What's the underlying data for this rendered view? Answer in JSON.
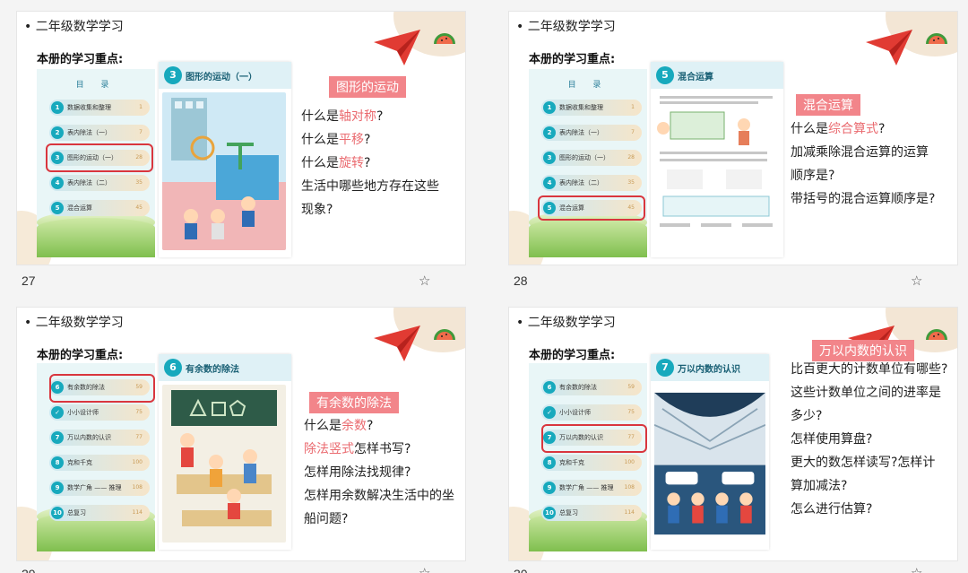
{
  "slides": [
    {
      "number": "27",
      "header": "二年级数学学习",
      "subheading": "本册的学习重点:",
      "toc_title": "目 录",
      "toc": [
        {
          "n": "1",
          "label": "数据收集和整理",
          "page": "1"
        },
        {
          "n": "2",
          "label": "表内除法（一）",
          "page": "7"
        },
        {
          "n": "3",
          "label": "图形的运动（一）",
          "page": "28"
        },
        {
          "n": "4",
          "label": "表内除法（二）",
          "page": "35"
        },
        {
          "n": "5",
          "label": "混合运算",
          "page": "45"
        }
      ],
      "chapter_num": "3",
      "chapter_title": "图形的运动（一）",
      "keyword": "图形的运动",
      "questions": [
        [
          {
            "t": "什么是"
          },
          {
            "t": "轴对称",
            "r": true
          },
          {
            "t": "?"
          }
        ],
        [
          {
            "t": "什么是"
          },
          {
            "t": "平移",
            "r": true
          },
          {
            "t": "?"
          }
        ],
        [
          {
            "t": "什么是"
          },
          {
            "t": "旋转",
            "r": true
          },
          {
            "t": "?"
          }
        ],
        [
          {
            "t": "生活中哪些地方存在这些"
          }
        ],
        [
          {
            "t": "现象?"
          }
        ]
      ]
    },
    {
      "number": "28",
      "header": "二年级数学学习",
      "subheading": "本册的学习重点:",
      "toc_title": "目 录",
      "toc": [
        {
          "n": "1",
          "label": "数据收集和整理",
          "page": "1"
        },
        {
          "n": "2",
          "label": "表内除法（一）",
          "page": "7"
        },
        {
          "n": "3",
          "label": "图形的运动（一）",
          "page": "28"
        },
        {
          "n": "4",
          "label": "表内除法（二）",
          "page": "35"
        },
        {
          "n": "5",
          "label": "混合运算",
          "page": "45"
        }
      ],
      "chapter_num": "5",
      "chapter_title": "混合运算",
      "keyword": "混合运算",
      "questions": [
        [
          {
            "t": "什么是"
          },
          {
            "t": "综合算式",
            "r": true
          },
          {
            "t": "?"
          }
        ],
        [
          {
            "t": "加减乘除混合运算的运算"
          }
        ],
        [
          {
            "t": "顺序是?"
          }
        ],
        [
          {
            "t": "带括号的混合运算顺序是?"
          }
        ]
      ]
    },
    {
      "number": "29",
      "header": "二年级数学学习",
      "subheading": "本册的学习重点:",
      "toc_title": "",
      "toc": [
        {
          "n": "6",
          "label": "有余数的除法",
          "page": "59"
        },
        {
          "n": "",
          "label": "小小设计师",
          "page": "75"
        },
        {
          "n": "7",
          "label": "万以内数的认识",
          "page": "77"
        },
        {
          "n": "8",
          "label": "克和千克",
          "page": "100"
        },
        {
          "n": "9",
          "label": "数学广角 —— 推理",
          "page": "108"
        },
        {
          "n": "10",
          "label": "总复习",
          "page": "114"
        }
      ],
      "chapter_num": "6",
      "chapter_title": "有余数的除法",
      "keyword": "有余数的除法",
      "questions": [
        [
          {
            "t": "什么是"
          },
          {
            "t": "余数",
            "r": true
          },
          {
            "t": "?"
          }
        ],
        [
          {
            "t": "除法竖式",
            "r": true
          },
          {
            "t": "怎样书写?"
          }
        ],
        [
          {
            "t": "怎样用除法找规律?"
          }
        ],
        [
          {
            "t": "怎样用余数解决生活中的坐"
          }
        ],
        [
          {
            "t": "船问题?"
          }
        ]
      ]
    },
    {
      "number": "30",
      "header": "二年级数学学习",
      "subheading": "本册的学习重点:",
      "toc_title": "",
      "toc": [
        {
          "n": "6",
          "label": "有余数的除法",
          "page": "59"
        },
        {
          "n": "",
          "label": "小小设计师",
          "page": "75"
        },
        {
          "n": "7",
          "label": "万以内数的认识",
          "page": "77"
        },
        {
          "n": "8",
          "label": "克和千克",
          "page": "100"
        },
        {
          "n": "9",
          "label": "数学广角 —— 推理",
          "page": "108"
        },
        {
          "n": "10",
          "label": "总复习",
          "page": "114"
        }
      ],
      "chapter_num": "7",
      "chapter_title": "万以内数的认识",
      "keyword": "万以内数的认识",
      "questions": [
        [
          {
            "t": "比百更大的计数单位有哪些?"
          }
        ],
        [
          {
            "t": "这些计数单位之间的进率是"
          }
        ],
        [
          {
            "t": "多少?"
          }
        ],
        [
          {
            "t": "怎样使用算盘?"
          }
        ],
        [
          {
            "t": "更大的数怎样读写?怎样计"
          }
        ],
        [
          {
            "t": "算加减法?"
          }
        ],
        [
          {
            "t": "怎么进行估算?"
          }
        ]
      ]
    }
  ],
  "icons": {
    "favorite": "star-outline-icon",
    "decor_plane": "paper-plane-icon",
    "decor_fruit": "watermelon-icon"
  },
  "colors": {
    "accent": "#f2858a",
    "highlight_text": "#ea6a6f",
    "teal": "#17a9bd",
    "toc_box": "#d9363e"
  }
}
